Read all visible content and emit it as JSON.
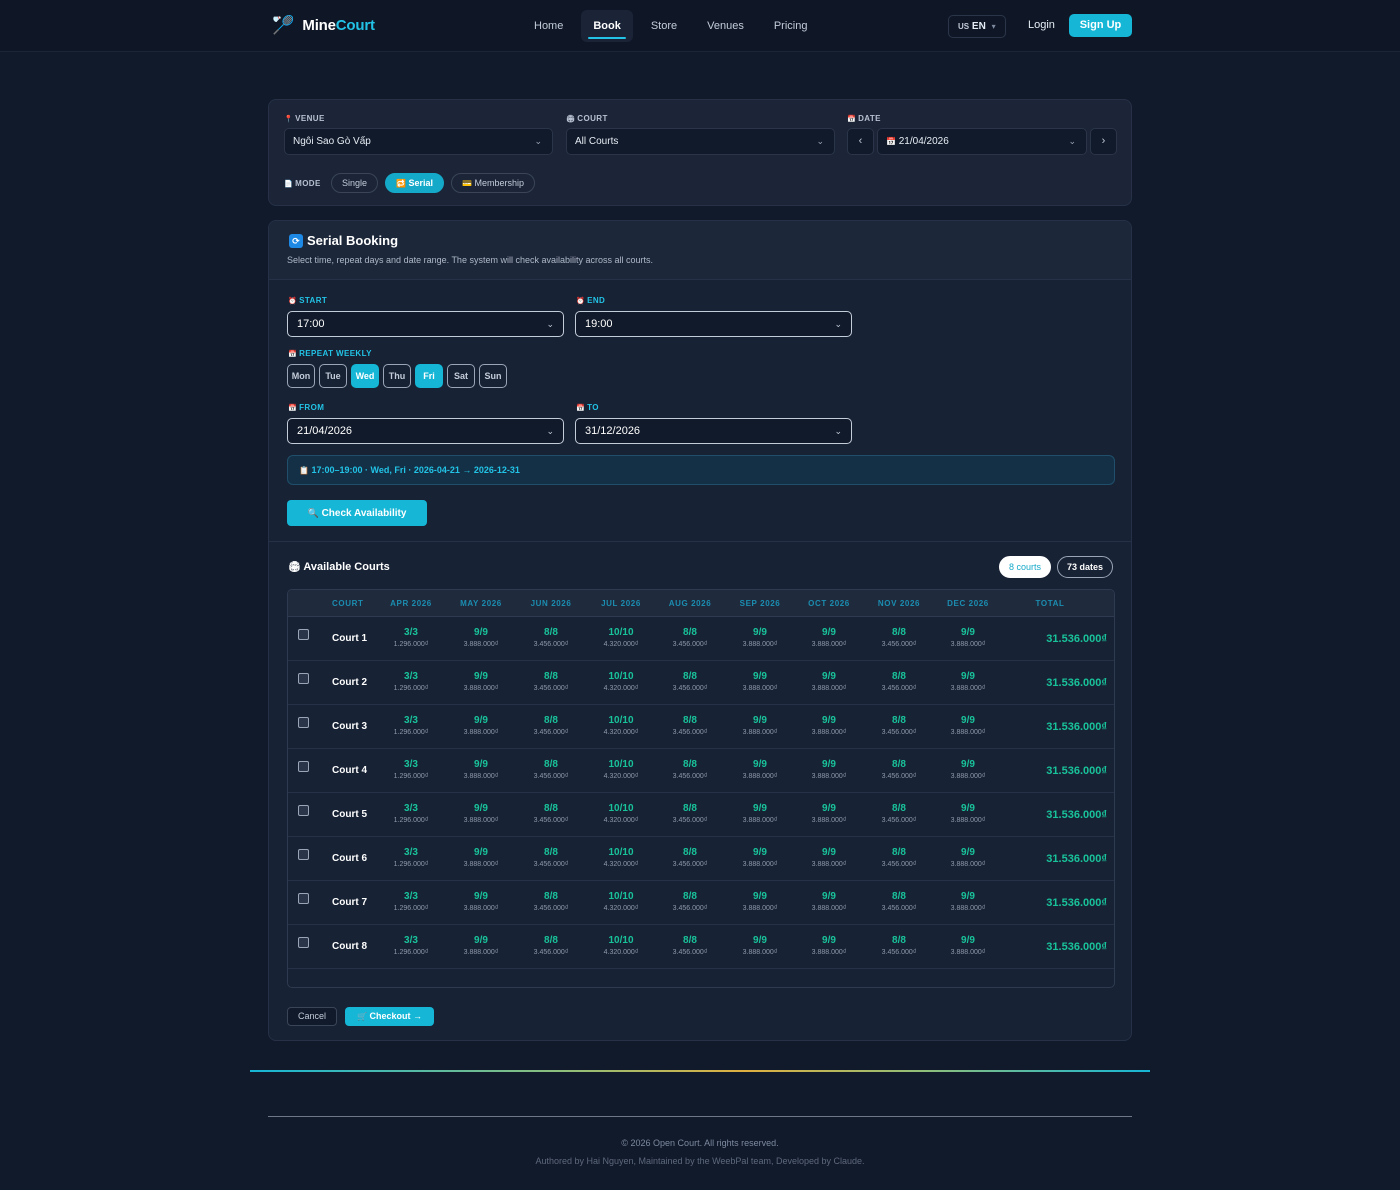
{
  "nav": {
    "brand_main": "Mine",
    "brand_accent": "Court",
    "brand_icon": "badminton-racket-icon",
    "items": [
      {
        "label": "Home",
        "active": false
      },
      {
        "label": "Book",
        "active": true
      },
      {
        "label": "Store",
        "active": false
      },
      {
        "label": "Venues",
        "active": false
      },
      {
        "label": "Pricing",
        "active": false
      }
    ],
    "lang_flag": "US",
    "lang": "EN",
    "login": "Login",
    "signup": "Sign Up"
  },
  "filter": {
    "venue_label": "VENUE",
    "venue_value": "Ngôi Sao Gò Vấp",
    "court_label": "COURT",
    "court_value": "All Courts",
    "date_label": "DATE",
    "date_value": "21/04/2026",
    "prev": "‹",
    "next": "›",
    "mode_label": "MODE",
    "modes": [
      {
        "label": "Single",
        "active": false
      },
      {
        "label": "Serial",
        "active": true
      },
      {
        "label": "Membership",
        "active": false
      }
    ]
  },
  "serial": {
    "title": "Serial Booking",
    "subtitle": "Select time, repeat days and date range. The system will check availability across all courts.",
    "start_label": "START",
    "start_value": "17:00",
    "end_label": "END",
    "end_value": "19:00",
    "repeat_label": "REPEAT WEEKLY",
    "days": [
      {
        "label": "Mon",
        "active": false
      },
      {
        "label": "Tue",
        "active": false
      },
      {
        "label": "Wed",
        "active": true
      },
      {
        "label": "Thu",
        "active": false
      },
      {
        "label": "Fri",
        "active": true
      },
      {
        "label": "Sat",
        "active": false
      },
      {
        "label": "Sun",
        "active": false
      }
    ],
    "from_label": "FROM",
    "from_value": "21/04/2026",
    "to_label": "TO",
    "to_value": "31/12/2026",
    "summary": "17:00–19:00 · Wed, Fri · 2026-04-21 → 2026-12-31",
    "check_button": "Check Availability"
  },
  "available": {
    "title": "Available Courts",
    "courts_badge": "8 courts",
    "dates_badge": "73 dates",
    "columns": [
      "COURT",
      "APR 2026",
      "MAY 2026",
      "JUN 2026",
      "JUL 2026",
      "AUG 2026",
      "SEP 2026",
      "OCT 2026",
      "NOV 2026",
      "DEC 2026",
      "TOTAL"
    ],
    "rows": [
      {
        "court": "Court 1",
        "cells": [
          [
            "3/3",
            "1.296.000₫"
          ],
          [
            "9/9",
            "3.888.000₫"
          ],
          [
            "8/8",
            "3.456.000₫"
          ],
          [
            "10/10",
            "4.320.000₫"
          ],
          [
            "8/8",
            "3.456.000₫"
          ],
          [
            "9/9",
            "3.888.000₫"
          ],
          [
            "9/9",
            "3.888.000₫"
          ],
          [
            "8/8",
            "3.456.000₫"
          ],
          [
            "9/9",
            "3.888.000₫"
          ]
        ],
        "total": "31.536.000₫"
      },
      {
        "court": "Court 2",
        "cells": [
          [
            "3/3",
            "1.296.000₫"
          ],
          [
            "9/9",
            "3.888.000₫"
          ],
          [
            "8/8",
            "3.456.000₫"
          ],
          [
            "10/10",
            "4.320.000₫"
          ],
          [
            "8/8",
            "3.456.000₫"
          ],
          [
            "9/9",
            "3.888.000₫"
          ],
          [
            "9/9",
            "3.888.000₫"
          ],
          [
            "8/8",
            "3.456.000₫"
          ],
          [
            "9/9",
            "3.888.000₫"
          ]
        ],
        "total": "31.536.000₫"
      },
      {
        "court": "Court 3",
        "cells": [
          [
            "3/3",
            "1.296.000₫"
          ],
          [
            "9/9",
            "3.888.000₫"
          ],
          [
            "8/8",
            "3.456.000₫"
          ],
          [
            "10/10",
            "4.320.000₫"
          ],
          [
            "8/8",
            "3.456.000₫"
          ],
          [
            "9/9",
            "3.888.000₫"
          ],
          [
            "9/9",
            "3.888.000₫"
          ],
          [
            "8/8",
            "3.456.000₫"
          ],
          [
            "9/9",
            "3.888.000₫"
          ]
        ],
        "total": "31.536.000₫"
      },
      {
        "court": "Court 4",
        "cells": [
          [
            "3/3",
            "1.296.000₫"
          ],
          [
            "9/9",
            "3.888.000₫"
          ],
          [
            "8/8",
            "3.456.000₫"
          ],
          [
            "10/10",
            "4.320.000₫"
          ],
          [
            "8/8",
            "3.456.000₫"
          ],
          [
            "9/9",
            "3.888.000₫"
          ],
          [
            "9/9",
            "3.888.000₫"
          ],
          [
            "8/8",
            "3.456.000₫"
          ],
          [
            "9/9",
            "3.888.000₫"
          ]
        ],
        "total": "31.536.000₫"
      },
      {
        "court": "Court 5",
        "cells": [
          [
            "3/3",
            "1.296.000₫"
          ],
          [
            "9/9",
            "3.888.000₫"
          ],
          [
            "8/8",
            "3.456.000₫"
          ],
          [
            "10/10",
            "4.320.000₫"
          ],
          [
            "8/8",
            "3.456.000₫"
          ],
          [
            "9/9",
            "3.888.000₫"
          ],
          [
            "9/9",
            "3.888.000₫"
          ],
          [
            "8/8",
            "3.456.000₫"
          ],
          [
            "9/9",
            "3.888.000₫"
          ]
        ],
        "total": "31.536.000₫"
      },
      {
        "court": "Court 6",
        "cells": [
          [
            "3/3",
            "1.296.000₫"
          ],
          [
            "9/9",
            "3.888.000₫"
          ],
          [
            "8/8",
            "3.456.000₫"
          ],
          [
            "10/10",
            "4.320.000₫"
          ],
          [
            "8/8",
            "3.456.000₫"
          ],
          [
            "9/9",
            "3.888.000₫"
          ],
          [
            "9/9",
            "3.888.000₫"
          ],
          [
            "8/8",
            "3.456.000₫"
          ],
          [
            "9/9",
            "3.888.000₫"
          ]
        ],
        "total": "31.536.000₫"
      },
      {
        "court": "Court 7",
        "cells": [
          [
            "3/3",
            "1.296.000₫"
          ],
          [
            "9/9",
            "3.888.000₫"
          ],
          [
            "8/8",
            "3.456.000₫"
          ],
          [
            "10/10",
            "4.320.000₫"
          ],
          [
            "8/8",
            "3.456.000₫"
          ],
          [
            "9/9",
            "3.888.000₫"
          ],
          [
            "9/9",
            "3.888.000₫"
          ],
          [
            "8/8",
            "3.456.000₫"
          ],
          [
            "9/9",
            "3.888.000₫"
          ]
        ],
        "total": "31.536.000₫"
      },
      {
        "court": "Court 8",
        "cells": [
          [
            "3/3",
            "1.296.000₫"
          ],
          [
            "9/9",
            "3.888.000₫"
          ],
          [
            "8/8",
            "3.456.000₫"
          ],
          [
            "10/10",
            "4.320.000₫"
          ],
          [
            "8/8",
            "3.456.000₫"
          ],
          [
            "9/9",
            "3.888.000₫"
          ],
          [
            "9/9",
            "3.888.000₫"
          ],
          [
            "8/8",
            "3.456.000₫"
          ],
          [
            "9/9",
            "3.888.000₫"
          ]
        ],
        "total": "31.536.000₫"
      }
    ],
    "cancel": "Cancel",
    "checkout": "Checkout →"
  },
  "footer": {
    "copyright": "© 2026 Open Court. All rights reserved.",
    "credits": "Authored by Hai Nguyen, Maintained by the WeebPal team, Developed by Claude."
  }
}
